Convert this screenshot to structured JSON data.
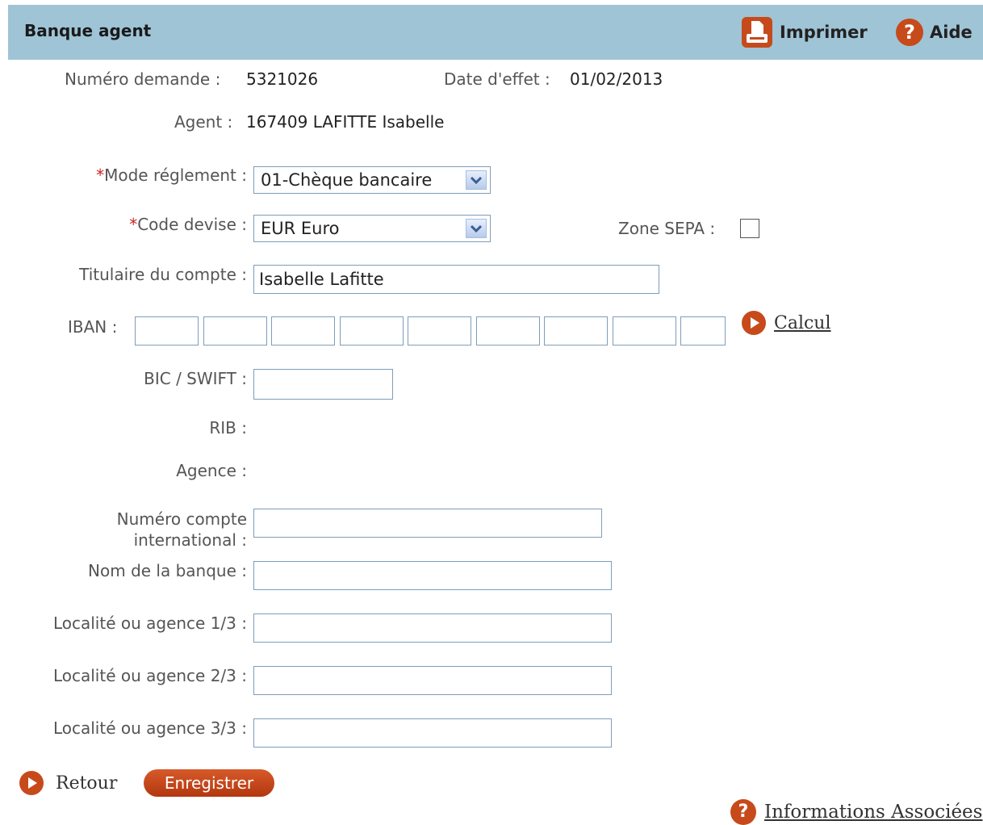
{
  "header": {
    "title": "Banque agent",
    "print_label": "Imprimer",
    "help_label": "Aide"
  },
  "info": {
    "numero_label": "Numéro demande :",
    "numero_value": "5321026",
    "date_label": "Date d'effet :",
    "date_value": "01/02/2013",
    "agent_label": "Agent :",
    "agent_value": "167409 LAFITTE Isabelle"
  },
  "form": {
    "required_mark": "*",
    "mode_label": "Mode réglement :",
    "mode_value": "01-Chèque bancaire",
    "devise_label": "Code devise :",
    "devise_value": "EUR Euro",
    "sepa_label": "Zone SEPA :",
    "titulaire_label": "Titulaire du compte :",
    "titulaire_value": "Isabelle Lafitte",
    "iban_label": "IBAN :",
    "calcul_label": "Calcul",
    "bic_label": "BIC / SWIFT :",
    "rib_label": "RIB :",
    "agence_label": "Agence :",
    "num_compte_label_1": "Numéro compte",
    "num_compte_label_2": "international :",
    "banque_label": "Nom de la banque :",
    "loc1_label": "Localité ou agence 1/3 :",
    "loc2_label": "Localité ou agence 2/3 :",
    "loc3_label": "Localité ou agence 3/3 :"
  },
  "footer": {
    "retour_label": "Retour",
    "enregistrer_label": "Enregistrer",
    "info_label": "Informations Associées"
  },
  "colors": {
    "header_bg": "#9fc4d6",
    "accent": "#c74a1a"
  }
}
